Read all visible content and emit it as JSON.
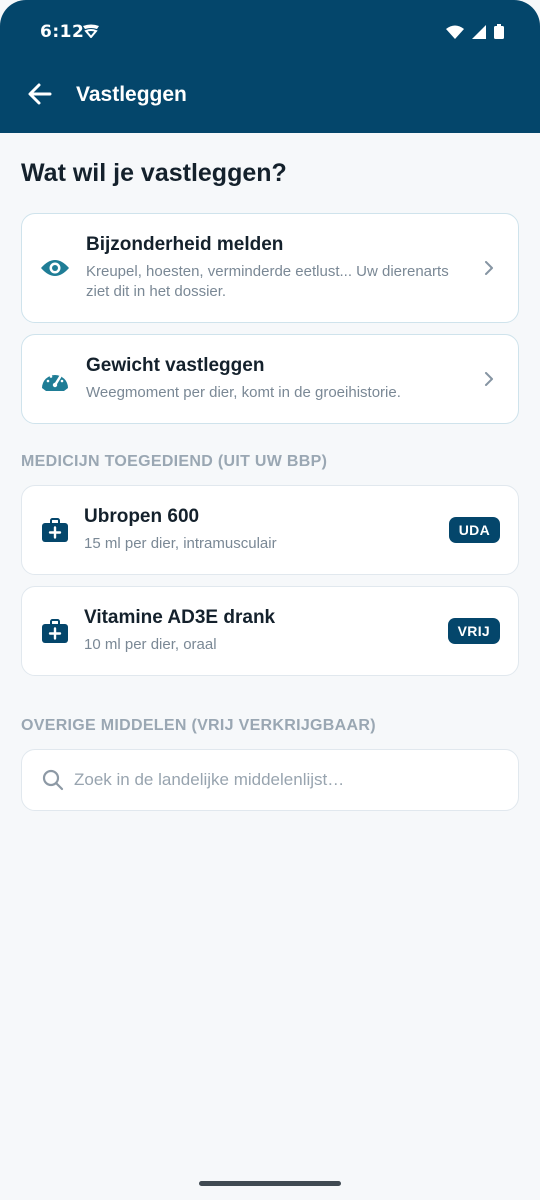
{
  "status": {
    "time": "6:12"
  },
  "appbar": {
    "title": "Vastleggen"
  },
  "page": {
    "title": "Wat wil je vastleggen?"
  },
  "actions": [
    {
      "title": "Bijzonderheid melden",
      "subtitle": "Kreupel, hoesten, verminderde eetlust... Uw dierenarts ziet dit in het dossier.",
      "icon": "eye-icon"
    },
    {
      "title": "Gewicht vastleggen",
      "subtitle": "Weegmoment per dier, komt in de groeihistorie.",
      "icon": "scale-gauge-icon"
    }
  ],
  "medicines_section": {
    "label": "MEDICIJN TOEGEDIEND (UIT UW BBP)"
  },
  "medicines": [
    {
      "title": "Ubropen 600",
      "subtitle": "15 ml per dier, intramusculair",
      "badge": "UDA",
      "icon": "medical-kit-icon"
    },
    {
      "title": "Vitamine AD3E drank",
      "subtitle": "10 ml per dier, oraal",
      "badge": "VRIJ",
      "icon": "medical-kit-icon"
    }
  ],
  "other_section": {
    "label": "OVERIGE MIDDELEN (VRIJ VERKRIJGBAAR)"
  },
  "search": {
    "placeholder": "Zoek in de landelijke middelenlijst…",
    "value": ""
  },
  "colors": {
    "primary": "#04466b",
    "accent_icon": "#1f7d96",
    "background": "#f6f8fa"
  }
}
